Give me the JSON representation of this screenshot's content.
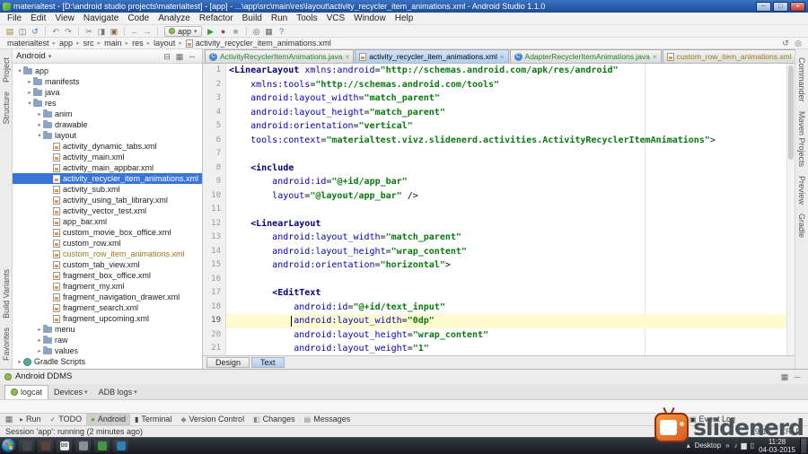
{
  "window": {
    "title": "materialtest - [D:\\android studio projects\\materialtest] - [app] - ...\\app\\src\\main\\res\\layout\\activity_recycler_item_animations.xml - Android Studio 1.1.0",
    "minimize": "─",
    "maximize": "□",
    "close": "×"
  },
  "menu": {
    "items": [
      "File",
      "Edit",
      "View",
      "Navigate",
      "Code",
      "Analyze",
      "Refactor",
      "Build",
      "Run",
      "Tools",
      "VCS",
      "Window",
      "Help"
    ]
  },
  "toolbar": {
    "icons": [
      {
        "name": "open-folder-icon",
        "glyph": "▤",
        "color": "#a07c3c"
      },
      {
        "name": "save-all-icon",
        "glyph": "◫",
        "color": "#5a6b8c"
      },
      {
        "name": "sync-icon",
        "glyph": "↺",
        "color": "#3c76b8"
      },
      {
        "sep": true
      },
      {
        "name": "undo-icon",
        "glyph": "↶",
        "color": "#888888"
      },
      {
        "name": "redo-icon",
        "glyph": "↷",
        "color": "#888888"
      },
      {
        "sep": true
      },
      {
        "name": "cut-icon",
        "glyph": "✂",
        "color": "#777777"
      },
      {
        "name": "copy-icon",
        "glyph": "◨",
        "color": "#777777"
      },
      {
        "name": "paste-icon",
        "glyph": "▣",
        "color": "#8a6d3b"
      },
      {
        "sep": true
      },
      {
        "name": "back-icon",
        "glyph": "←",
        "color": "#888888"
      },
      {
        "name": "forward-icon",
        "glyph": "→",
        "color": "#888888"
      },
      {
        "sep": true
      },
      {
        "label": "app"
      },
      {
        "name": "run-icon",
        "glyph": "▶",
        "color": "#2f9e2f"
      },
      {
        "name": "debug-icon",
        "glyph": "●",
        "color": "#9e4a3a"
      },
      {
        "name": "stop-icon",
        "glyph": "■",
        "color": "#aaaaaa"
      },
      {
        "sep": true
      },
      {
        "name": "search-icon",
        "glyph": "◎",
        "color": "#555555"
      },
      {
        "name": "settings-icon",
        "glyph": "▦",
        "color": "#666666"
      },
      {
        "name": "help-icon",
        "glyph": "?",
        "color": "#3c76b8"
      }
    ],
    "run_config": {
      "label": "app"
    }
  },
  "breadcrumbs": {
    "items": [
      "materialtest",
      "app",
      "src",
      "main",
      "res",
      "layout",
      "activity_recycler_item_animations.xml"
    ],
    "right_icons": [
      {
        "name": "history-icon",
        "glyph": "↺"
      },
      {
        "name": "search-icon",
        "glyph": "◎"
      }
    ]
  },
  "docks": {
    "left_top": [
      "Project",
      "Structure"
    ],
    "left_bottom": [
      "Build Variants",
      "Favorites"
    ],
    "right": [
      "Commander",
      "Maven Projects",
      "Preview",
      "Gradle"
    ]
  },
  "project": {
    "selector": "Android",
    "header_icons": [
      {
        "name": "collapse-all-icon",
        "glyph": "⊟"
      },
      {
        "name": "settings-icon",
        "glyph": "▦"
      },
      {
        "name": "hide-panel-icon",
        "glyph": "─"
      }
    ],
    "tree": [
      {
        "lv": 0,
        "arrow": "v",
        "icon": "folder",
        "label": "app"
      },
      {
        "lv": 1,
        "arrow": ">",
        "icon": "folder",
        "label": "manifests"
      },
      {
        "lv": 1,
        "arrow": ">",
        "icon": "folder",
        "label": "java"
      },
      {
        "lv": 1,
        "arrow": "v",
        "icon": "folder",
        "label": "res"
      },
      {
        "lv": 2,
        "arrow": ">",
        "icon": "folder",
        "label": "anim"
      },
      {
        "lv": 2,
        "arrow": ">",
        "icon": "folder",
        "label": "drawable"
      },
      {
        "lv": 2,
        "arrow": "v",
        "icon": "folder",
        "label": "layout"
      },
      {
        "lv": 3,
        "icon": "xml",
        "label": "activity_dynamic_tabs.xml"
      },
      {
        "lv": 3,
        "icon": "xml",
        "label": "activity_main.xml"
      },
      {
        "lv": 3,
        "icon": "xml",
        "label": "activity_main_appbar.xml"
      },
      {
        "lv": 3,
        "icon": "xml",
        "label": "activity_recycler_item_animations.xml",
        "selected": true
      },
      {
        "lv": 3,
        "icon": "xml",
        "label": "activity_sub.xml"
      },
      {
        "lv": 3,
        "icon": "xml",
        "label": "activity_using_tab_library.xml"
      },
      {
        "lv": 3,
        "icon": "xml",
        "label": "activity_vector_test.xml"
      },
      {
        "lv": 3,
        "icon": "xml",
        "label": "app_bar.xml"
      },
      {
        "lv": 3,
        "icon": "xml",
        "label": "custom_movie_box_office.xml"
      },
      {
        "lv": 3,
        "icon": "xml",
        "label": "custom_row.xml"
      },
      {
        "lv": 3,
        "icon": "xml",
        "label": "custom_row_item_animations.xml",
        "color": "#9e7a1a"
      },
      {
        "lv": 3,
        "icon": "xml",
        "label": "custom_tab_view.xml"
      },
      {
        "lv": 3,
        "icon": "xml",
        "label": "fragment_box_office.xml"
      },
      {
        "lv": 3,
        "icon": "xml",
        "label": "fragment_my.xml"
      },
      {
        "lv": 3,
        "icon": "xml",
        "label": "fragment_navigation_drawer.xml"
      },
      {
        "lv": 3,
        "icon": "xml",
        "label": "fragment_search.xml"
      },
      {
        "lv": 3,
        "icon": "xml",
        "label": "fragment_upcoming.xml"
      },
      {
        "lv": 2,
        "arrow": ">",
        "icon": "folder",
        "label": "menu"
      },
      {
        "lv": 2,
        "arrow": ">",
        "icon": "folder",
        "label": "raw"
      },
      {
        "lv": 2,
        "arrow": ">",
        "icon": "folder",
        "label": "values"
      },
      {
        "lv": 0,
        "arrow": ">",
        "icon": "gradle",
        "label": "Gradle Scripts"
      }
    ]
  },
  "editor": {
    "tabs": [
      {
        "label": "ActivityRecyclerItemAnimations.java",
        "kind": "java",
        "color": "#2a8029",
        "active": false
      },
      {
        "label": "activity_recycler_item_animations.xml",
        "kind": "xml",
        "color": "#000000",
        "active": true
      },
      {
        "label": "AdapterRecyclerItemAnimations.java",
        "kind": "java",
        "color": "#2a8029",
        "active": false
      },
      {
        "label": "custom_row_item_animations.xml",
        "kind": "xml",
        "color": "#9e7a1a",
        "active": false
      }
    ],
    "highlight_line": 19,
    "caret_col": 13,
    "design_tabs": [
      "Design",
      "Text"
    ],
    "active_design_tab": "Text",
    "lines": [
      {
        "n": 1,
        "t": [
          [
            "g",
            "<LinearLayout"
          ],
          [
            "p",
            " "
          ],
          [
            "a",
            "xmlns:android"
          ],
          [
            "p",
            "="
          ],
          [
            "s",
            "\"http://schemas.android.com/apk/res/android\""
          ]
        ]
      },
      {
        "n": 2,
        "t": [
          [
            "p",
            "    "
          ],
          [
            "a",
            "xmlns:tools"
          ],
          [
            "p",
            "="
          ],
          [
            "s",
            "\"http://schemas.android.com/tools\""
          ]
        ]
      },
      {
        "n": 3,
        "t": [
          [
            "p",
            "    "
          ],
          [
            "a",
            "android:layout_width"
          ],
          [
            "p",
            "="
          ],
          [
            "s",
            "\"match_parent\""
          ]
        ]
      },
      {
        "n": 4,
        "t": [
          [
            "p",
            "    "
          ],
          [
            "a",
            "android:layout_height"
          ],
          [
            "p",
            "="
          ],
          [
            "s",
            "\"match_parent\""
          ]
        ]
      },
      {
        "n": 5,
        "t": [
          [
            "p",
            "    "
          ],
          [
            "a",
            "android:orientation"
          ],
          [
            "p",
            "="
          ],
          [
            "s",
            "\"vertical\""
          ]
        ]
      },
      {
        "n": 6,
        "t": [
          [
            "p",
            "    "
          ],
          [
            "a",
            "tools:context"
          ],
          [
            "p",
            "="
          ],
          [
            "s",
            "\"materialtest.vivz.slidenerd.activities.ActivityRecyclerItemAnimations\""
          ],
          [
            "p",
            ">"
          ]
        ]
      },
      {
        "n": 7,
        "t": []
      },
      {
        "n": 8,
        "t": [
          [
            "p",
            "    "
          ],
          [
            "g",
            "<include"
          ]
        ]
      },
      {
        "n": 9,
        "t": [
          [
            "p",
            "        "
          ],
          [
            "a",
            "android:id"
          ],
          [
            "p",
            "="
          ],
          [
            "s",
            "\"@+id/app_bar\""
          ]
        ]
      },
      {
        "n": 10,
        "t": [
          [
            "p",
            "        "
          ],
          [
            "a",
            "layout"
          ],
          [
            "p",
            "="
          ],
          [
            "s",
            "\"@layout/app_bar\""
          ],
          [
            "p",
            " />"
          ]
        ]
      },
      {
        "n": 11,
        "t": []
      },
      {
        "n": 12,
        "t": [
          [
            "p",
            "    "
          ],
          [
            "g",
            "<LinearLayout"
          ]
        ]
      },
      {
        "n": 13,
        "t": [
          [
            "p",
            "        "
          ],
          [
            "a",
            "android:layout_width"
          ],
          [
            "p",
            "="
          ],
          [
            "s",
            "\"match_parent\""
          ]
        ]
      },
      {
        "n": 14,
        "t": [
          [
            "p",
            "        "
          ],
          [
            "a",
            "android:layout_height"
          ],
          [
            "p",
            "="
          ],
          [
            "s",
            "\"wrap_content\""
          ]
        ]
      },
      {
        "n": 15,
        "t": [
          [
            "p",
            "        "
          ],
          [
            "a",
            "android:orientation"
          ],
          [
            "p",
            "="
          ],
          [
            "s",
            "\"horizontal\""
          ],
          [
            "p",
            ">"
          ]
        ]
      },
      {
        "n": 16,
        "t": []
      },
      {
        "n": 17,
        "t": [
          [
            "p",
            "        "
          ],
          [
            "g",
            "<EditText"
          ]
        ]
      },
      {
        "n": 18,
        "t": [
          [
            "p",
            "            "
          ],
          [
            "a",
            "android:id"
          ],
          [
            "p",
            "="
          ],
          [
            "s",
            "\"@+id/text_input\""
          ]
        ]
      },
      {
        "n": 19,
        "t": [
          [
            "p",
            "            "
          ],
          [
            "a",
            "android:layout_width"
          ],
          [
            "p",
            "="
          ],
          [
            "s",
            "\"0dp\""
          ]
        ]
      },
      {
        "n": 20,
        "t": [
          [
            "p",
            "            "
          ],
          [
            "a",
            "android:layout_height"
          ],
          [
            "p",
            "="
          ],
          [
            "s",
            "\"wrap_content\""
          ]
        ]
      },
      {
        "n": 21,
        "t": [
          [
            "p",
            "            "
          ],
          [
            "a",
            "android:layout_weight"
          ],
          [
            "p",
            "="
          ],
          [
            "s",
            "\"1\""
          ]
        ]
      }
    ]
  },
  "ddms": {
    "title": "Android DDMS",
    "header_icons": [
      {
        "name": "ddms-settings-icon",
        "glyph": "▦"
      },
      {
        "name": "ddms-minimize-icon",
        "glyph": "─"
      }
    ],
    "tabs": [
      {
        "label": "logcat",
        "active": true
      }
    ],
    "buttons": [
      "Devices",
      "ADB logs"
    ]
  },
  "bottom_bar": {
    "items": [
      {
        "label": "Run",
        "icon": "run-tool-icon",
        "glyph": "▸",
        "color": "#556677"
      },
      {
        "label": "TODO",
        "icon": "todo-icon",
        "glyph": "✓",
        "color": "#556677"
      },
      {
        "label": "Android",
        "icon": "android-tool-icon",
        "glyph": "●",
        "color": "#67a43a",
        "active": true
      },
      {
        "label": "Terminal",
        "icon": "terminal-icon",
        "glyph": "▮",
        "color": "#444444"
      },
      {
        "label": "Version Control",
        "icon": "version-control-icon",
        "glyph": "◆",
        "color": "#888888"
      },
      {
        "label": "Changes",
        "icon": "changes-icon",
        "glyph": "◧",
        "color": "#888888"
      },
      {
        "label": "Messages",
        "icon": "messages-icon",
        "glyph": "▤",
        "color": "#888888"
      }
    ],
    "event_log": "Event Log",
    "event_log_glyph": "▣"
  },
  "status": {
    "message": "Session 'app': running (2 minutes ago)",
    "caret_position": "19:13",
    "line_ending": "CRLF"
  },
  "taskbar": {
    "apps": [
      {
        "name": "taskbar-app-icon-1",
        "color": "#43484e",
        "glyph": ""
      },
      {
        "name": "taskbar-app-icon-2",
        "color": "#5d4037",
        "glyph": ""
      },
      {
        "name": "taskbar-app-icon-3",
        "color": "#e8e8e8",
        "glyph": "oo"
      },
      {
        "name": "taskbar-app-icon-4",
        "color": "#8a8f96",
        "glyph": ""
      },
      {
        "name": "taskbar-app-icon-5",
        "color": "#3f9b43",
        "glyph": ""
      },
      {
        "name": "taskbar-app-icon-6",
        "color": "#2e7fb8",
        "glyph": ""
      }
    ],
    "tray_icons": [
      {
        "name": "volume-icon",
        "glyph": "♪"
      },
      {
        "name": "network-icon",
        "glyph": "▆"
      },
      {
        "name": "battery-icon",
        "glyph": "▯"
      }
    ],
    "hidden_icons_arrow": "▴",
    "desktop_label": "Desktop",
    "chevron": "»",
    "time": "11:28",
    "date": "04-03-2015"
  },
  "watermark": {
    "text": "slidenerd"
  }
}
